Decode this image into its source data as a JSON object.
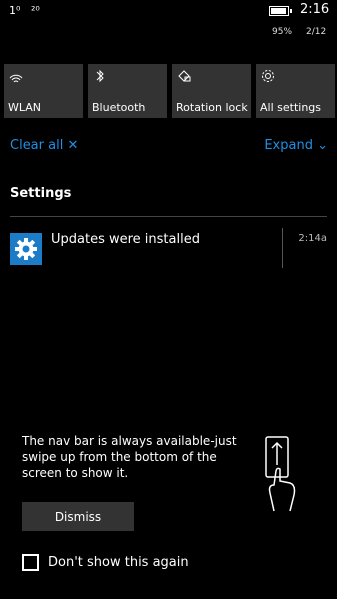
{
  "status_bar": {
    "signal_1": "1⁰",
    "signal_2": "²⁰",
    "time": "2:16",
    "battery_percent": "95%",
    "battery_level": 0.95,
    "date": "2/12"
  },
  "quick_actions": [
    {
      "label": "WLAN",
      "icon": "wifi-icon"
    },
    {
      "label": "Bluetooth",
      "icon": "bluetooth-icon"
    },
    {
      "label": "Rotation lock",
      "icon": "rotation-lock-icon"
    },
    {
      "label": "All settings",
      "icon": "gear-icon"
    }
  ],
  "actions": {
    "clear_all": "Clear all ✕",
    "expand": "Expand ⌄"
  },
  "notifications": {
    "group_title": "Settings",
    "items": [
      {
        "text": "Updates were installed",
        "time": "2:14a",
        "icon": "settings-gear-icon"
      }
    ]
  },
  "tip": {
    "text": "The nav bar is always available-just swipe up from the bottom of the screen to show it.",
    "dismiss_label": "Dismiss",
    "checkbox_label": "Don't show this again",
    "checkbox_checked": false
  },
  "colors": {
    "accent": "#1e90e6",
    "tile_bg": "#333333",
    "settings_icon_bg": "#1c7cc7"
  }
}
